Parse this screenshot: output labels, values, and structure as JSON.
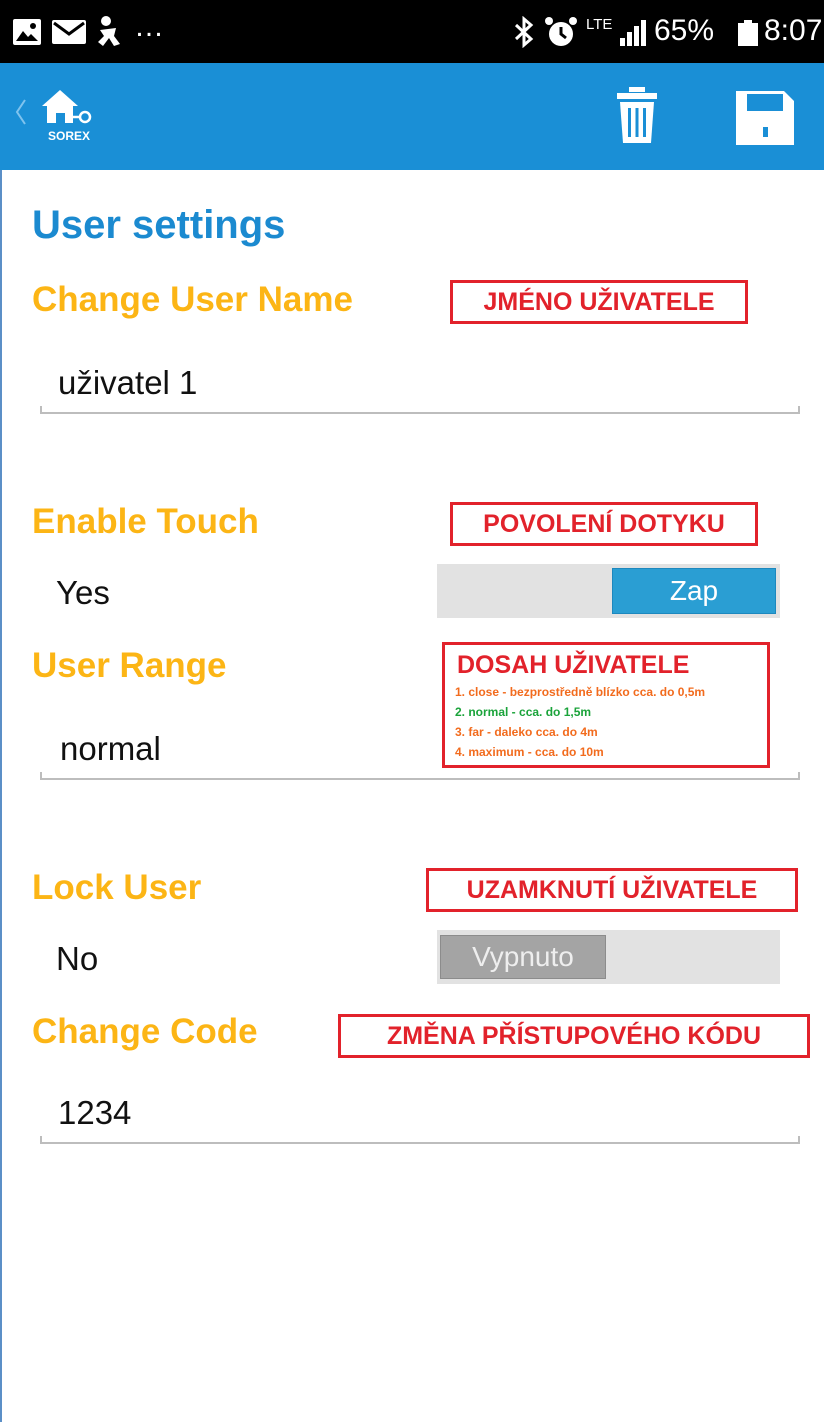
{
  "status_bar": {
    "notifications_more": "…",
    "network": "LTE",
    "battery": "65%",
    "time": "8:07"
  },
  "app_bar": {
    "logo_text": "SOREX",
    "back_icon": "chevron-left-icon",
    "delete_icon": "trash-icon",
    "save_icon": "floppy-disk-icon"
  },
  "page": {
    "title": "User settings"
  },
  "settings": {
    "user_name": {
      "label": "Change User Name",
      "value": "uživatel 1",
      "annotation": "JMÉNO UŽIVATELE"
    },
    "enable_touch": {
      "label": "Enable Touch",
      "value": "Yes",
      "toggle_text": "Zap",
      "toggle_on": true,
      "annotation": "POVOLENÍ DOTYKU"
    },
    "user_range": {
      "label": "User Range",
      "value": "normal",
      "annotation": "DOSAH UŽIVATELE",
      "annotation_lines": [
        "1. close - bezprostředně blízko cca. do 0,5m",
        "2. normal - cca. do 1,5m",
        "3. far - daleko cca. do 4m",
        "4. maximum - cca. do 10m"
      ]
    },
    "lock_user": {
      "label": "Lock User",
      "value": "No",
      "toggle_text": "Vypnuto",
      "toggle_on": false,
      "annotation": "UZAMKNUTÍ UŽIVATELE"
    },
    "change_code": {
      "label": "Change Code",
      "value": "1234",
      "annotation": "ZMĚNA PŘÍSTUPOVÉHO KÓDU"
    }
  },
  "colors": {
    "app_bar": "#1a8fd6",
    "title": "#1b8ad0",
    "label": "#fcb515",
    "annotation": "#e2222b",
    "toggle_on": "#2a9ed3",
    "toggle_off": "#a4a4a4",
    "range_line_green": "#1aa33a",
    "range_line_orange": "#f26b1d"
  }
}
